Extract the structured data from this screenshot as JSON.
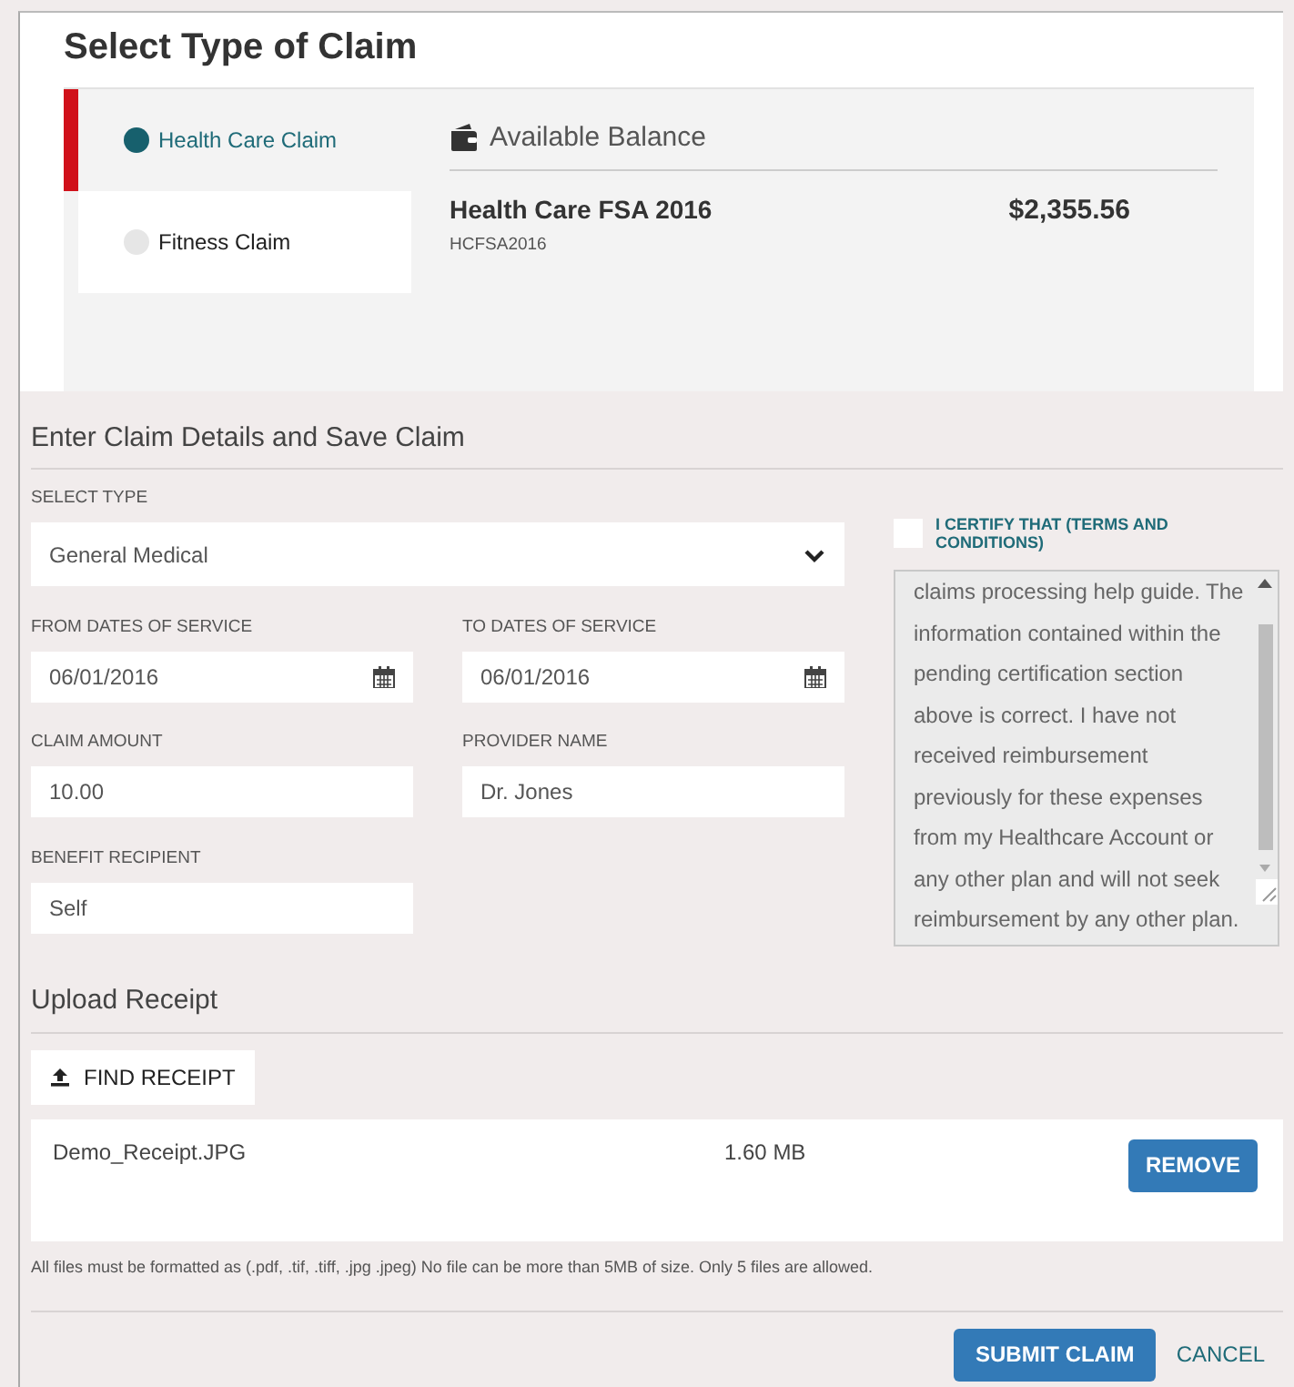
{
  "claim_type": {
    "title": "Select Type of Claim",
    "options": [
      {
        "label": "Health Care Claim",
        "selected": true
      },
      {
        "label": "Fitness Claim",
        "selected": false
      }
    ],
    "balance": {
      "heading": "Available Balance",
      "accounts": [
        {
          "name": "Health Care FSA 2016",
          "code": "HCFSA2016",
          "amount": "$2,355.56"
        }
      ]
    }
  },
  "claim_details": {
    "heading": "Enter Claim Details and Save Claim",
    "fields": [
      {
        "label": "SELECT TYPE",
        "value": "General Medical",
        "kind": "select"
      },
      {
        "label": "FROM DATES OF SERVICE",
        "value": "06/01/2016",
        "kind": "date"
      },
      {
        "label": "TO DATES OF SERVICE",
        "value": "06/01/2016",
        "kind": "date"
      },
      {
        "label": "CLAIM AMOUNT",
        "value": "10.00",
        "kind": "text"
      },
      {
        "label": "PROVIDER NAME",
        "value": "Dr. Jones",
        "kind": "text"
      },
      {
        "label": "BENEFIT RECIPIENT",
        "value": "Self",
        "kind": "text"
      }
    ],
    "certify": {
      "label": "I CERTIFY THAT (TERMS AND CONDITIONS)",
      "checked": false,
      "terms": "claims processing help guide. The information contained within the pending certification section above is correct. I have not received reimbursement previously for these expenses from my Healthcare Account or any other plan and will not seek reimbursement by any other plan."
    }
  },
  "upload": {
    "heading": "Upload Receipt",
    "button": "FIND RECEIPT",
    "files": [
      {
        "name": "Demo_Receipt.JPG",
        "size": "1.60 MB",
        "action": "REMOVE"
      }
    ],
    "note": "All files must be formatted as (.pdf, .tif, .tiff, .jpg .jpeg) No file can be more than 5MB of size. Only 5 files are allowed."
  },
  "actions": {
    "submit": "SUBMIT CLAIM",
    "cancel": "CANCEL"
  }
}
